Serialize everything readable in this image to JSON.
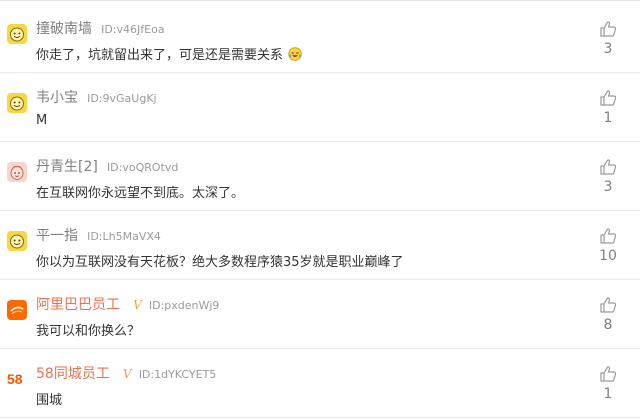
{
  "comments": [
    {
      "name": "撞破南墙",
      "id": "ID:v46JfEoa",
      "text": "你走了，坑就留出来了，可是还是需要关系",
      "likes": "3",
      "avatar": "yellow-face-icon",
      "verified": false,
      "emoji": "crying-laugh-emoji"
    },
    {
      "name": "韦小宝",
      "id": "ID:9vGaUgKj",
      "text": "M",
      "likes": "1",
      "avatar": "yellow-face-icon",
      "verified": false
    },
    {
      "name": "丹青生[2]",
      "id": "ID:voQROtvd",
      "text": "在互联网你永远望不到底。太深了。",
      "likes": "3",
      "avatar": "pink-cartoon-avatar",
      "verified": false
    },
    {
      "name": "平一指",
      "id": "ID:Lh5MaVX4",
      "text": "你以为互联网没有天花板？绝大多数程序猿35岁就是职业巅峰了",
      "likes": "10",
      "avatar": "yellow-face-icon",
      "verified": false
    },
    {
      "name": "阿里巴巴员工",
      "id": "ID:pxdenWj9",
      "text": "我可以和你换么？",
      "likes": "8",
      "avatar": "alibaba-logo-avatar",
      "verified": true
    },
    {
      "name": "58同城员工",
      "id": "ID:1dYKCYET5",
      "text": "围城",
      "likes": "1",
      "avatar": "58-logo-avatar",
      "verified": true,
      "logo_text": "58"
    }
  ],
  "verified_mark": "V",
  "colors": {
    "name_gray": "#808080",
    "name_vip": "#eb7350",
    "verified_mark": "#f1a23a",
    "text": "#333333",
    "divider": "#e9e9e9"
  }
}
